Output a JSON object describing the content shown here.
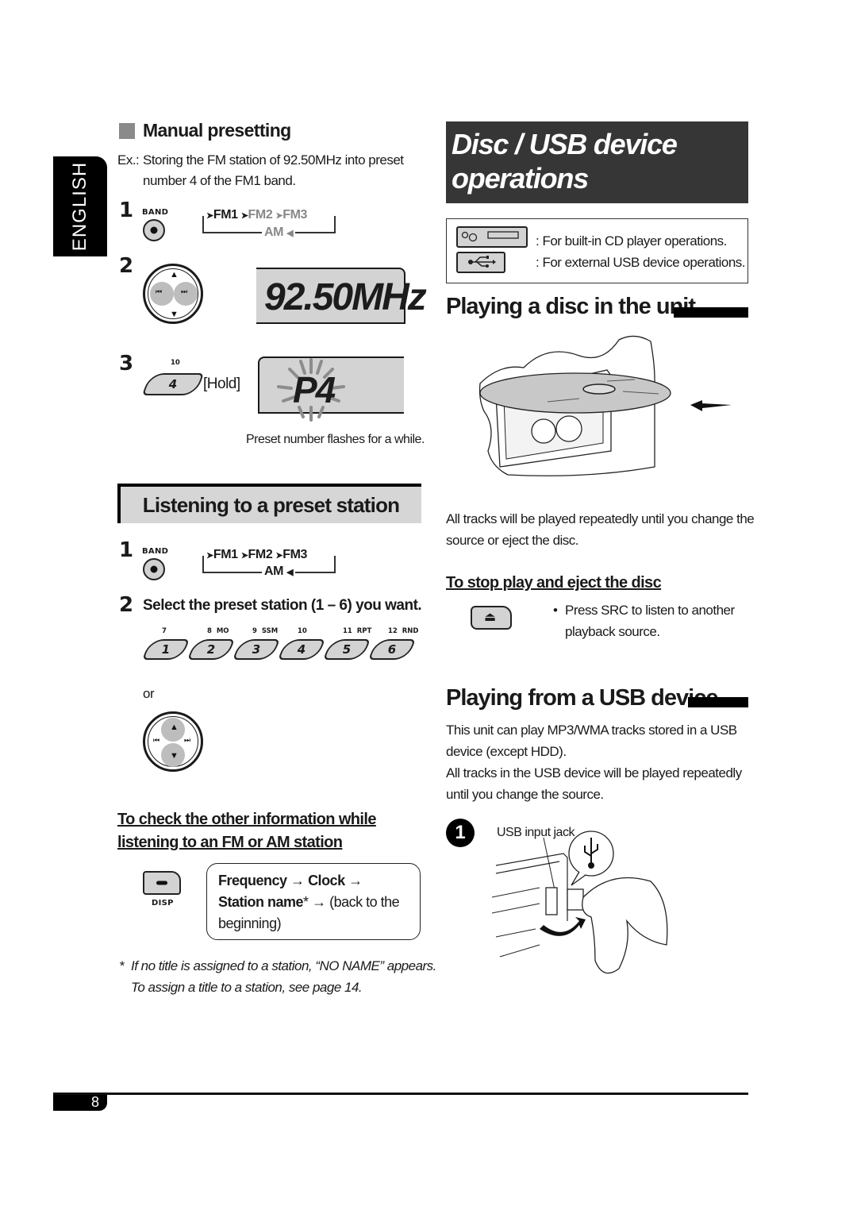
{
  "language_tab": "ENGLISH",
  "left": {
    "manual_presetting": {
      "heading": "Manual presetting",
      "example_prefix": "Ex.:",
      "example_line1": "Storing the FM station of 92.50MHz into preset",
      "example_line2": "number 4 of the FM1 band.",
      "step1": {
        "number": "1",
        "button_label": "BAND",
        "cycle": [
          "FM1",
          "FM2",
          "FM3",
          "AM"
        ],
        "highlighted": "FM1"
      },
      "step2": {
        "number": "2",
        "display": "92.50MHz"
      },
      "step3": {
        "number": "3",
        "key_sub_label": "10",
        "key_label": "4",
        "hold_label": "[Hold]",
        "display": "P4",
        "caption": "Preset number flashes for a while."
      }
    },
    "listening_preset": {
      "heading": "Listening to a preset station",
      "step1": {
        "number": "1",
        "button_label": "BAND",
        "cycle": [
          "FM1",
          "FM2",
          "FM3",
          "AM"
        ]
      },
      "step2": {
        "number": "2",
        "text": "Select the preset station (1 – 6) you want.",
        "keys": [
          {
            "label": "1",
            "sub": "7"
          },
          {
            "label": "2",
            "sub": "8  MO"
          },
          {
            "label": "3",
            "sub": "9  SSM"
          },
          {
            "label": "4",
            "sub": "10"
          },
          {
            "label": "5",
            "sub": "11  RPT"
          },
          {
            "label": "6",
            "sub": "12  RND"
          }
        ],
        "or_label": "or"
      }
    },
    "check_info": {
      "heading_line1": "To check the other information while",
      "heading_line2": "listening to an FM or AM station",
      "button_label": "DISP",
      "seq_frequency": "Frequency",
      "seq_clock": "Clock",
      "seq_station": "Station name",
      "seq_star": "*",
      "seq_back": "(back to the",
      "seq_back2": "beginning)",
      "arrow": "→"
    },
    "footnote_mark": "*",
    "footnote_line1": "If no title is assigned to a station, “NO NAME” appears.",
    "footnote_line2": "To assign a title to a station, see page 14."
  },
  "right": {
    "title_line1": "Disc / USB device",
    "title_line2": "operations",
    "legend": {
      "cd_text": ":  For built-in CD player operations.",
      "usb_text": ":  For external USB device operations."
    },
    "playing_disc": {
      "heading": "Playing a disc in the unit",
      "body_line1": "All tracks will be played repeatedly until you change the",
      "body_line2": "source or eject the disc.",
      "subheading": "To stop play and eject the disc",
      "bullet": "•",
      "bullet_line1": "Press SRC to listen to another",
      "bullet_line2": "playback source."
    },
    "playing_usb": {
      "heading": "Playing from a USB device",
      "line1": "This unit can play MP3/WMA tracks stored in a USB",
      "line2": "device (except HDD).",
      "line3": "All tracks in the USB device will be played repeatedly",
      "line4": "until you change the source.",
      "step_number": "1",
      "jack_label": "USB input jack"
    }
  },
  "page_number": "8"
}
